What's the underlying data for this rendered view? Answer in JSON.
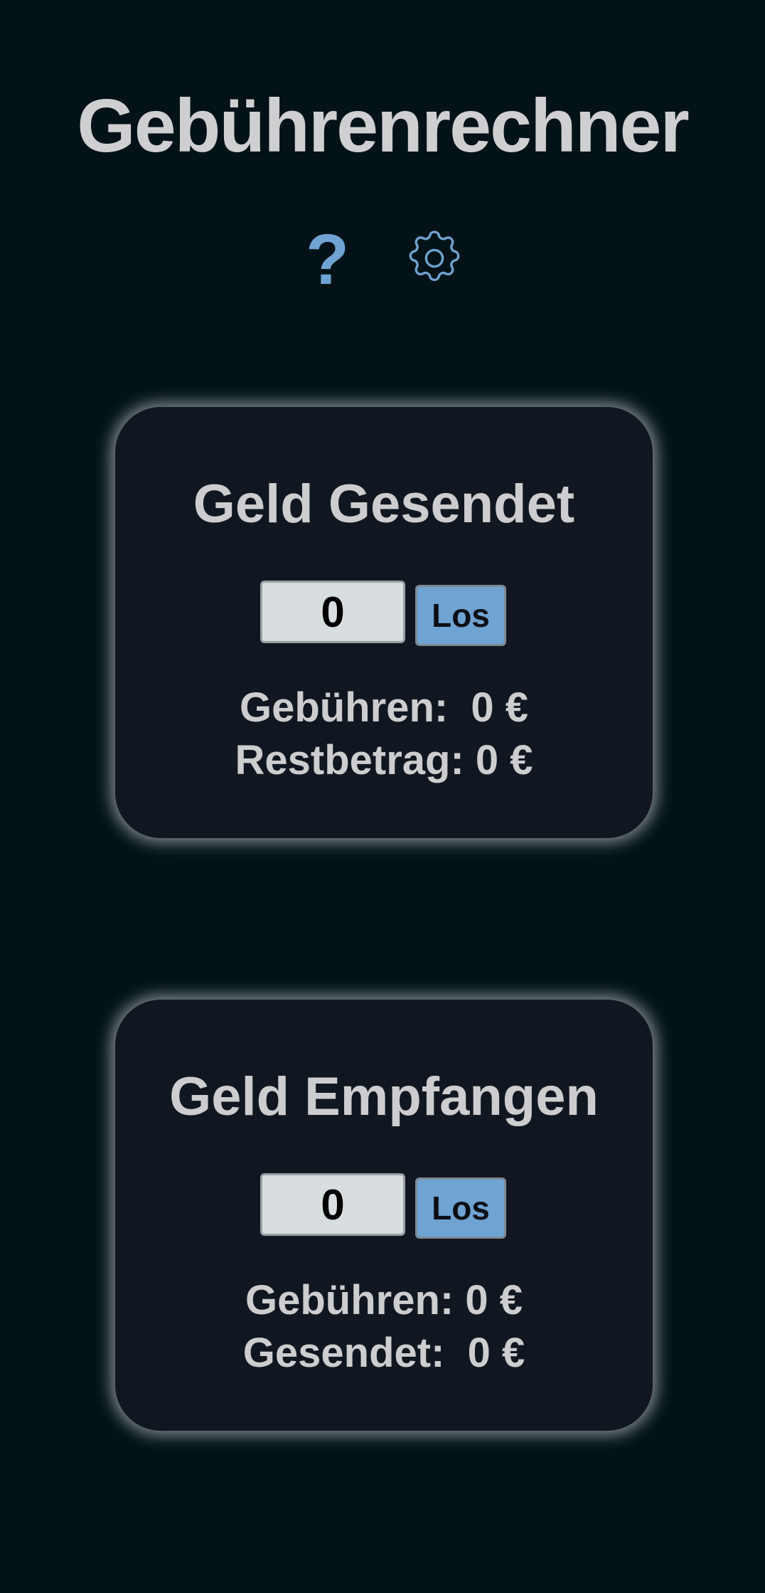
{
  "app": {
    "title": "Gebührenrechner"
  },
  "toolbar": {
    "help_icon": "question-mark-icon",
    "help_glyph": "?",
    "settings_icon": "gear-icon"
  },
  "colors": {
    "background": "#021217",
    "card": "#111720",
    "accent": "#6fa3d2",
    "text": "#cdcdcf",
    "input_bg": "#d8dde0"
  },
  "cards": [
    {
      "title": "Geld Gesendet",
      "input_value": "0",
      "button_label": "Los",
      "lines": [
        "Gebühren:  0 €",
        "Restbetrag: 0 €"
      ]
    },
    {
      "title": "Geld Empfangen",
      "input_value": "0",
      "button_label": "Los",
      "lines": [
        "Gebühren: 0 €",
        "Gesendet:  0 €"
      ]
    }
  ]
}
